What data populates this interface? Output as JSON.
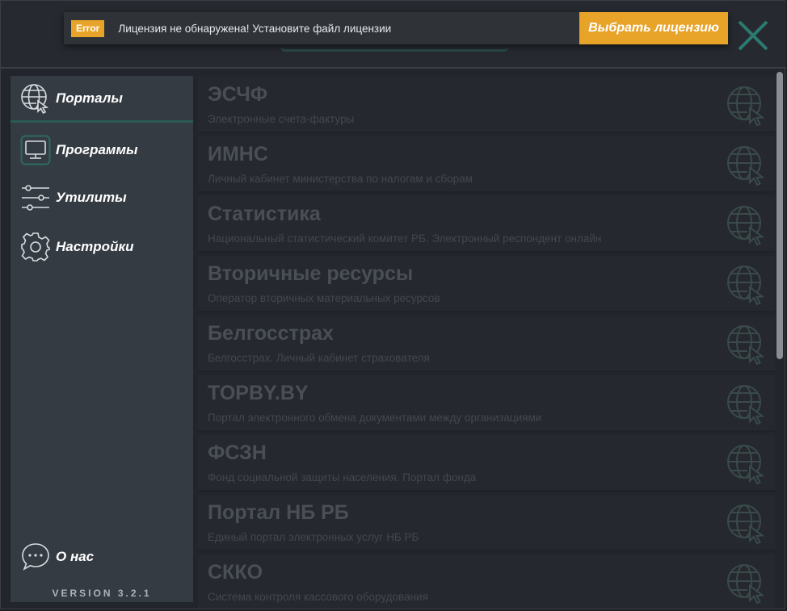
{
  "notification": {
    "badge": "Error",
    "message": "Лицензия не обнаружена! Установите файл лицензии",
    "button_label": "Выбрать лицензию"
  },
  "colors": {
    "accent": "#2a6b63",
    "warning": "#e8a329",
    "sidebar_bg": "#353b42",
    "list_bg": "#25292f"
  },
  "sidebar": {
    "items": [
      {
        "label": "Порталы",
        "icon": "globe-cursor-icon"
      },
      {
        "label": "Программы",
        "icon": "monitor-icon"
      },
      {
        "label": "Утилиты",
        "icon": "sliders-icon"
      },
      {
        "label": "Настройки",
        "icon": "gear-icon"
      }
    ],
    "about": {
      "label": "О нас",
      "icon": "chat-bubble-icon"
    },
    "version": "VERSION 3.2.1"
  },
  "portals": [
    {
      "title": "ЭСЧФ",
      "subtitle": "Электронные счета-фактуры"
    },
    {
      "title": "ИМНС",
      "subtitle": "Личный кабинет министерства по налогам и сборам"
    },
    {
      "title": "Статистика",
      "subtitle": "Национальный статистический комитет РБ. Электронный респондент онлайн"
    },
    {
      "title": "Вторичные ресурсы",
      "subtitle": "Оператор вторичных материальных ресурсов"
    },
    {
      "title": "Белгосстрах",
      "subtitle": "Белгосстрах. Личный кабинет страхователя"
    },
    {
      "title": "TOPBY.BY",
      "subtitle": "Портал электронного обмена документами между организациями"
    },
    {
      "title": "ФСЗН",
      "subtitle": "Фонд социальной защиты населения. Портал фонда"
    },
    {
      "title": "Портал НБ РБ",
      "subtitle": "Единый портал электронных услуг НБ РБ"
    },
    {
      "title": "СККО",
      "subtitle": "Система контроля кассового оборудования"
    }
  ]
}
